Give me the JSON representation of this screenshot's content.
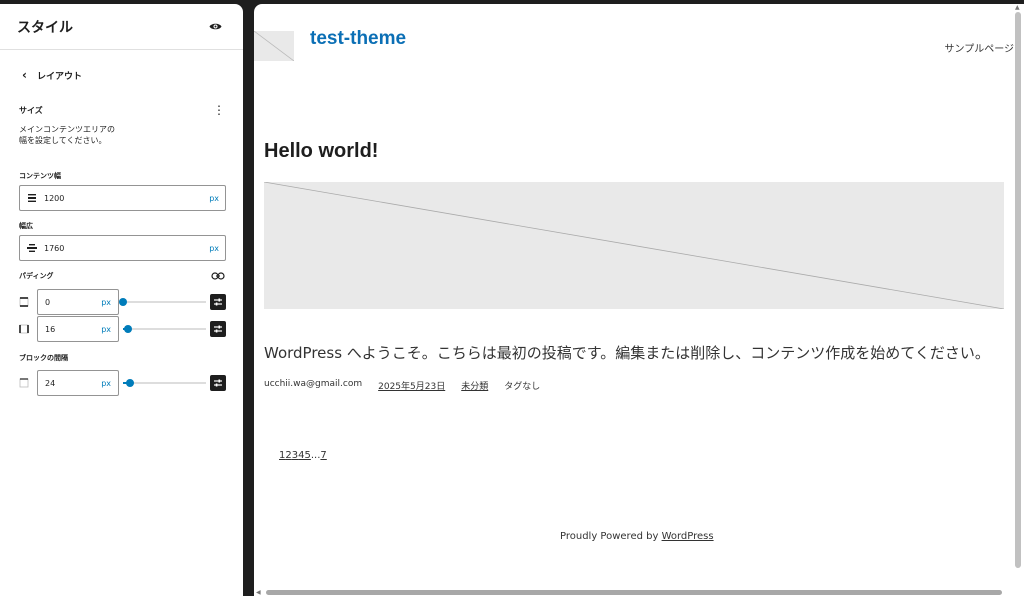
{
  "sidebar": {
    "title": "スタイル",
    "back_label": "レイアウト",
    "section_title": "サイズ",
    "description": "メインコンテンツエリアの幅を設定してください。",
    "content_width": {
      "label": "コンテンツ幅",
      "value": "1200",
      "unit": "px"
    },
    "wide_width": {
      "label": "幅広",
      "value": "1760",
      "unit": "px"
    },
    "padding": {
      "label": "パディング",
      "vertical": {
        "value": "0",
        "unit": "px",
        "slider_fraction": 0.0
      },
      "horizontal": {
        "value": "16",
        "unit": "px",
        "slider_fraction": 0.06
      }
    },
    "block_spacing": {
      "label": "ブロックの間隔",
      "value": "24",
      "unit": "px",
      "slider_fraction": 0.09
    }
  },
  "preview": {
    "site_title": "test-theme",
    "nav_link": "サンプルページ",
    "post_title": "Hello world!",
    "excerpt": "WordPress へようこそ。こちらは最初の投稿です。編集または削除し、コンテンツ作成を始めてください。",
    "meta": {
      "author": "ucchii.wa@gmail.com",
      "date": "2025年5月23日",
      "category": "未分類",
      "tags": "タグなし"
    },
    "pagination": {
      "p1": "1",
      "p2": "2",
      "p3": "3",
      "p4": "4",
      "p5": "5",
      "dots": "...",
      "p7": "7"
    },
    "footer": {
      "prefix": "Proudly Powered by ",
      "link": "WordPress"
    }
  },
  "colors": {
    "accent": "#007cba",
    "site_title": "#0b6fb5",
    "dark": "#1e1e1e"
  },
  "icons": [
    "eye-icon",
    "chevron-left-icon",
    "more-vertical-icon",
    "content-width-icon",
    "wide-width-icon",
    "link-icon",
    "padding-vertical-icon",
    "padding-horizontal-icon",
    "settings-sliders-icon",
    "block-spacing-icon"
  ]
}
